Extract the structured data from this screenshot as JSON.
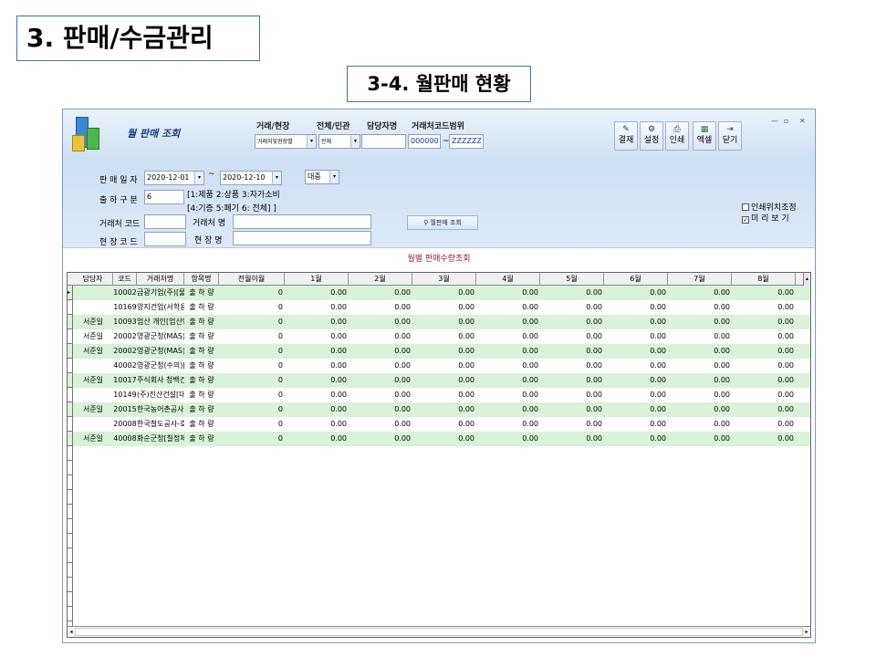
{
  "slide": {
    "title": "3. 판매/수금관리",
    "subtitle": "3-4. 월판매 현황"
  },
  "window": {
    "title": "월 판매 조회",
    "controls": [
      "—",
      "▫",
      "✕"
    ]
  },
  "top_filters": {
    "type_label": "거래/현장",
    "type_value": "거래처및현장별",
    "scope_label": "전체/민관",
    "scope_value": "전체",
    "manager_label": "담당자명",
    "manager_value": "",
    "range_label": "거래처코드범위",
    "range_from": "000000",
    "range_sep": "~",
    "range_to": "ZZZZZZ"
  },
  "toolbar": [
    {
      "name": "approve",
      "label": "결재",
      "icon": "approve-icon"
    },
    {
      "name": "settings",
      "label": "설정",
      "icon": "settings-icon"
    },
    {
      "name": "print",
      "label": "인쇄",
      "icon": "print-icon"
    },
    {
      "name": "excel",
      "label": "엑셀",
      "icon": "excel-icon"
    },
    {
      "name": "close",
      "label": "닫기",
      "icon": "exit-icon"
    }
  ],
  "filters": {
    "date_label": "판 매 일 자",
    "date_from": "2020-12-01",
    "date_sep": "~",
    "date_to": "2020-12-10",
    "unit_value": "대중",
    "ship_label": "출 하 구 분",
    "ship_value": "6",
    "ship_hint1": "[1:제품 2:상품 3:자가소비",
    "ship_hint2": "[4:기증 5:폐기 6: 전체] ]",
    "cust_code_label": "거래처 코드",
    "cust_code_value": "",
    "cust_name_label": "거래처 명",
    "cust_name_value": "",
    "site_code_label": "현 장 코 드",
    "site_code_value": "",
    "site_name_label": "현 장 명",
    "site_name_value": "",
    "query_button": "월판매 조회",
    "print_pos_label": "인쇄위치조정",
    "preview_label": "미 리 보 기",
    "preview_checked": "✓"
  },
  "grid": {
    "title": "월별 판매수량조회",
    "columns": [
      "담당자",
      "코드",
      "거래처명",
      "항목명",
      "전월이월",
      "1월",
      "2월",
      "3월",
      "4월",
      "5월",
      "6월",
      "7월",
      "8월"
    ],
    "rows": [
      {
        "manager": "",
        "code": "10002",
        "name": "금광기업(주)[물김.",
        "item": "출 하 량",
        "carry": "0",
        "months": [
          "0.00",
          "0.00",
          "0.00",
          "0.00",
          "0.00",
          "0.00",
          "0.00",
          "0.00"
        ]
      },
      {
        "manager": "",
        "code": "10169",
        "name": "양지건업(서학용)[",
        "item": "출 하 량",
        "carry": "0",
        "months": [
          "0.00",
          "0.00",
          "0.00",
          "0.00",
          "0.00",
          "0.00",
          "0.00",
          "0.00"
        ]
      },
      {
        "manager": "서준일",
        "code": "10093",
        "name": "엄산 개인[엄산면 ;",
        "item": "출 하 량",
        "carry": "0",
        "months": [
          "0.00",
          "0.00",
          "0.00",
          "0.00",
          "0.00",
          "0.00",
          "0.00",
          "0.00"
        ]
      },
      {
        "manager": "서준일",
        "code": "20002",
        "name": "영광군청(MAS)[법",
        "item": "출 하 량",
        "carry": "0",
        "months": [
          "0.00",
          "0.00",
          "0.00",
          "0.00",
          "0.00",
          "0.00",
          "0.00",
          "0.00"
        ]
      },
      {
        "manager": "서준일",
        "code": "20002",
        "name": "영광군청(MAS)[영",
        "item": "출 하 량",
        "carry": "0",
        "months": [
          "0.00",
          "0.00",
          "0.00",
          "0.00",
          "0.00",
          "0.00",
          "0.00",
          "0.00"
        ]
      },
      {
        "manager": "",
        "code": "40002",
        "name": "영광군청(수의)[군:",
        "item": "출 하 량",
        "carry": "0",
        "months": [
          "0.00",
          "0.00",
          "0.00",
          "0.00",
          "0.00",
          "0.00",
          "0.00",
          "0.00"
        ]
      },
      {
        "manager": "서준일",
        "code": "10017",
        "name": "주식회사 청백건설",
        "item": "출 하 량",
        "carry": "0",
        "months": [
          "0.00",
          "0.00",
          "0.00",
          "0.00",
          "0.00",
          "0.00",
          "0.00",
          "0.00"
        ]
      },
      {
        "manager": "",
        "code": "10149",
        "name": "(주)진산건설[대동!",
        "item": "출 하 량",
        "carry": "0",
        "months": [
          "0.00",
          "0.00",
          "0.00",
          "0.00",
          "0.00",
          "0.00",
          "0.00",
          "0.00"
        ]
      },
      {
        "manager": "서준일",
        "code": "20015",
        "name": "한국농어촌공사 강:",
        "item": "출 하 량",
        "carry": "0",
        "months": [
          "0.00",
          "0.00",
          "0.00",
          "0.00",
          "0.00",
          "0.00",
          "0.00",
          "0.00"
        ]
      },
      {
        "manager": "",
        "code": "20008",
        "name": "한국철도공사-호남",
        "item": "출 하 량",
        "carry": "0",
        "months": [
          "0.00",
          "0.00",
          "0.00",
          "0.00",
          "0.00",
          "0.00",
          "0.00",
          "0.00"
        ]
      },
      {
        "manager": "서준일",
        "code": "40008",
        "name": "화순군청[칠정제매",
        "item": "출 하 량",
        "carry": "0",
        "months": [
          "0.00",
          "0.00",
          "0.00",
          "0.00",
          "0.00",
          "0.00",
          "0.00",
          "0.00"
        ]
      }
    ],
    "row_highlight": [
      true,
      false,
      true,
      false,
      true,
      false,
      true,
      false,
      true,
      false,
      true
    ],
    "row_selected_marker": "▸",
    "scroll_left": "◂",
    "scroll_right": "▸",
    "scroll_up": "▴"
  },
  "colors": {
    "highlight_row": "#d8f3d8",
    "header_bg": "#cddff3",
    "grid_title": "#9b1a3a"
  }
}
